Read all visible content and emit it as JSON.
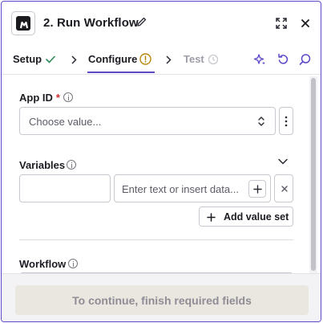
{
  "header": {
    "title": "2. Run Workflow",
    "icons": [
      "app-logo",
      "pencil-icon",
      "expand-icon",
      "close-icon"
    ]
  },
  "tabs": [
    {
      "label": "Setup",
      "state": "complete"
    },
    {
      "label": "Configure",
      "state": "active-warning"
    },
    {
      "label": "Test",
      "state": "disabled"
    }
  ],
  "toolbar_icons": [
    "sparkle-icon",
    "refresh-icon",
    "search-icon"
  ],
  "fields": {
    "app_id": {
      "label": "App ID",
      "required_mark": "*",
      "placeholder": "Choose value..."
    },
    "variables": {
      "label": "Variables",
      "value_placeholder": "Enter text or insert data...",
      "add_value_set_label": "Add value set"
    },
    "workflow": {
      "label": "Workflow"
    }
  },
  "footer": {
    "continue_label": "To continue, finish required fields"
  },
  "colors": {
    "accent": "#5b49c9",
    "success": "#2e8b57",
    "warning": "#b8860b",
    "required": "#d02f2f"
  }
}
